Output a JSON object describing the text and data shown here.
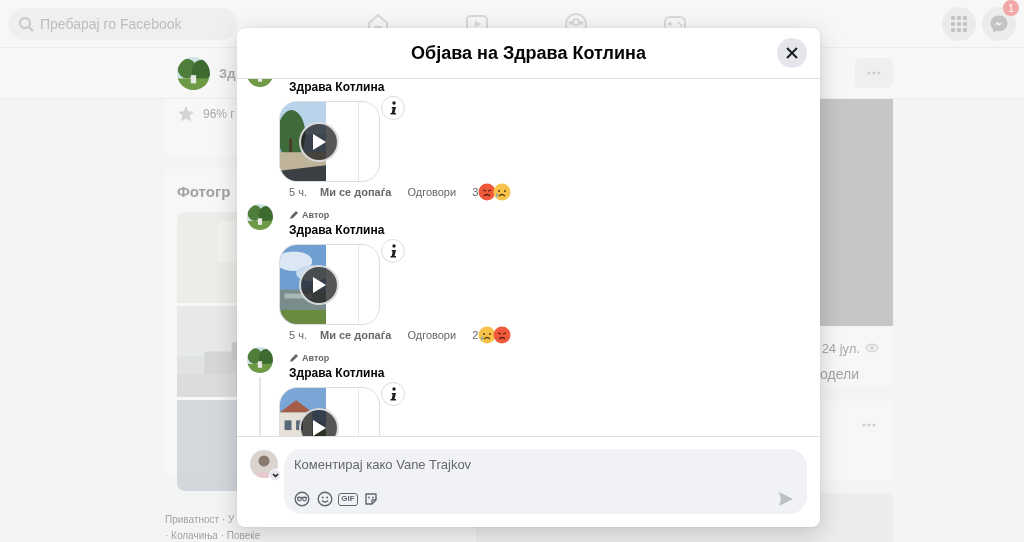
{
  "topbar": {
    "search_placeholder": "Пребарај го Facebook",
    "notification_badge": "1"
  },
  "page_header": {
    "name": "Зд"
  },
  "left_column": {
    "rating": "96% г",
    "photos_title": "Фотогр",
    "photos": [
      {
        "kind": "picture"
      },
      {
        "kind": "picture"
      },
      {
        "kind": "picture"
      }
    ],
    "footer_links": [
      "Приватност · У",
      "· Колачиња · Повеќе"
    ]
  },
  "right_column": {
    "post_date": "24 јул.",
    "share_label": "одели"
  },
  "dialog": {
    "title": "Објава на Здрава Котлина",
    "comments": [
      {
        "author": "Здрава Котлина",
        "time": "5 ч.",
        "like": "Ми се допаѓа",
        "reply": "Одговори",
        "reaction_count": "3",
        "reactions": [
          {
            "kind": "angry"
          },
          {
            "kind": "sad"
          }
        ],
        "has_replies": false
      },
      {
        "author_badge": "Автор",
        "author": "Здрава Котлина",
        "time": "5 ч.",
        "like": "Ми се допаѓа",
        "reply": "Одговори",
        "reaction_count": "2",
        "reactions": [
          {
            "kind": "sad"
          },
          {
            "kind": "angry"
          }
        ],
        "has_replies": false
      },
      {
        "author_badge": "Автор",
        "author": "Здрава Котлина",
        "has_replies": true
      }
    ],
    "composer": {
      "placeholder": "Коментирај како Vane Trajkov",
      "gif_label": "GIF"
    }
  }
}
